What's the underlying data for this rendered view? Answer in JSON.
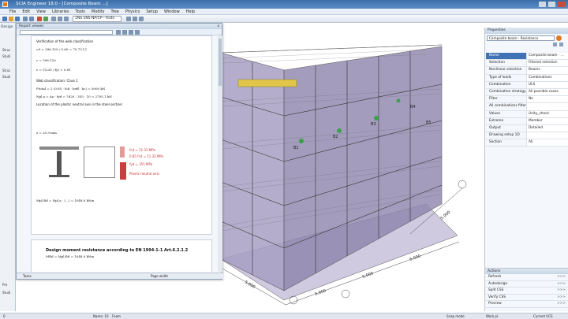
{
  "window": {
    "title": "SCIA Engineer 18.0 - [Composite Beam ...]"
  },
  "menu": [
    "File",
    "Edit",
    "View",
    "Libraries",
    "Tools",
    "Modify",
    "Tree",
    "Physics",
    "Setup",
    "Window",
    "Help"
  ],
  "toolbar": {
    "combo_value": "1NS 1NS  NP/CP - Rsltn"
  },
  "left_panel": {
    "tab": "Design",
    "items": [
      "Struc",
      "Studi",
      "Struc",
      "Studi",
      "Pre",
      "Studi"
    ]
  },
  "report": {
    "title": "Report viewer",
    "close": "x",
    "lines": [
      "Verification of the web classification",
      "c/t = 396.120 / 5.60 = 70.73 [-]",
      "c = 396.120",
      "ε = √(235 / fy) = 0.81",
      "Web classification: Class 1",
      "Ftotal = 2 (0.85 · fck · beff · hc) = 5000 kN",
      "Npl,a = Aa · fyd = 7620 · 355 · 10 = 2705.1 kN",
      "Location of the plastic neutral axis in the steel section:",
      "z = 20.9 mm",
      "Mpl,Rd = Npl,a · (...) = 1048.0 kNm"
    ],
    "diagram_labels": [
      "fcd = 11.33 MPa",
      "0.85 fcd = 11.33 MPa",
      "fyd = 355 MPa",
      "Plastic neutral axis"
    ],
    "page2_heading": "Design moment resistance according to EN 1994-1-1 Art.6.2.1.2",
    "page2_sub": "MRd = Mpl,Rd = 1048.0 kNm",
    "footer_tabs": "Tasks",
    "footer_fit": "Page width"
  },
  "viewport": {
    "dimension_labels": [
      "5.000",
      "5.000",
      "5.000",
      "5.000",
      "5.000"
    ],
    "member_labels": [
      "B1",
      "B2",
      "B3",
      "B4",
      "B5"
    ]
  },
  "properties": {
    "header": "Properties",
    "combo": "Composite beam - Resistance",
    "rows": [
      {
        "k": "Name",
        "v": "Composite beam - ...",
        "sel": true
      },
      {
        "k": "Selection",
        "v": "Filtered selection"
      },
      {
        "k": "Nonlinear selection",
        "v": "Beams"
      },
      {
        "k": "Type of loads",
        "v": "Combinations"
      },
      {
        "k": "Combination",
        "v": "ULS"
      },
      {
        "k": "Combination strategy",
        "v": "All possible cases"
      },
      {
        "k": "Filter",
        "v": "No"
      },
      {
        "k": "All combinations filter",
        "v": ""
      },
      {
        "k": "Values",
        "v": "Unity_check"
      },
      {
        "k": "Extreme",
        "v": "Member"
      },
      {
        "k": "Output",
        "v": "Detailed"
      },
      {
        "k": "Drawing setup 1D",
        "v": ""
      },
      {
        "k": "Section",
        "v": "All"
      }
    ]
  },
  "actions": {
    "header": "Actions",
    "rows": [
      "Refresh",
      "Autodesign",
      "Split CSS",
      "Verify CSS",
      "Preview"
    ],
    "chevron": ">>>"
  },
  "status": {
    "left": "0",
    "items": [
      "Name: 10",
      "Foam",
      "Snap mode",
      "Work pl.",
      "Current UCS"
    ]
  },
  "colors": {
    "accent": "#3f73b5",
    "titlebar": "#3b6ea8",
    "building": "#8d84ad",
    "highlight": "#e2c64a"
  }
}
